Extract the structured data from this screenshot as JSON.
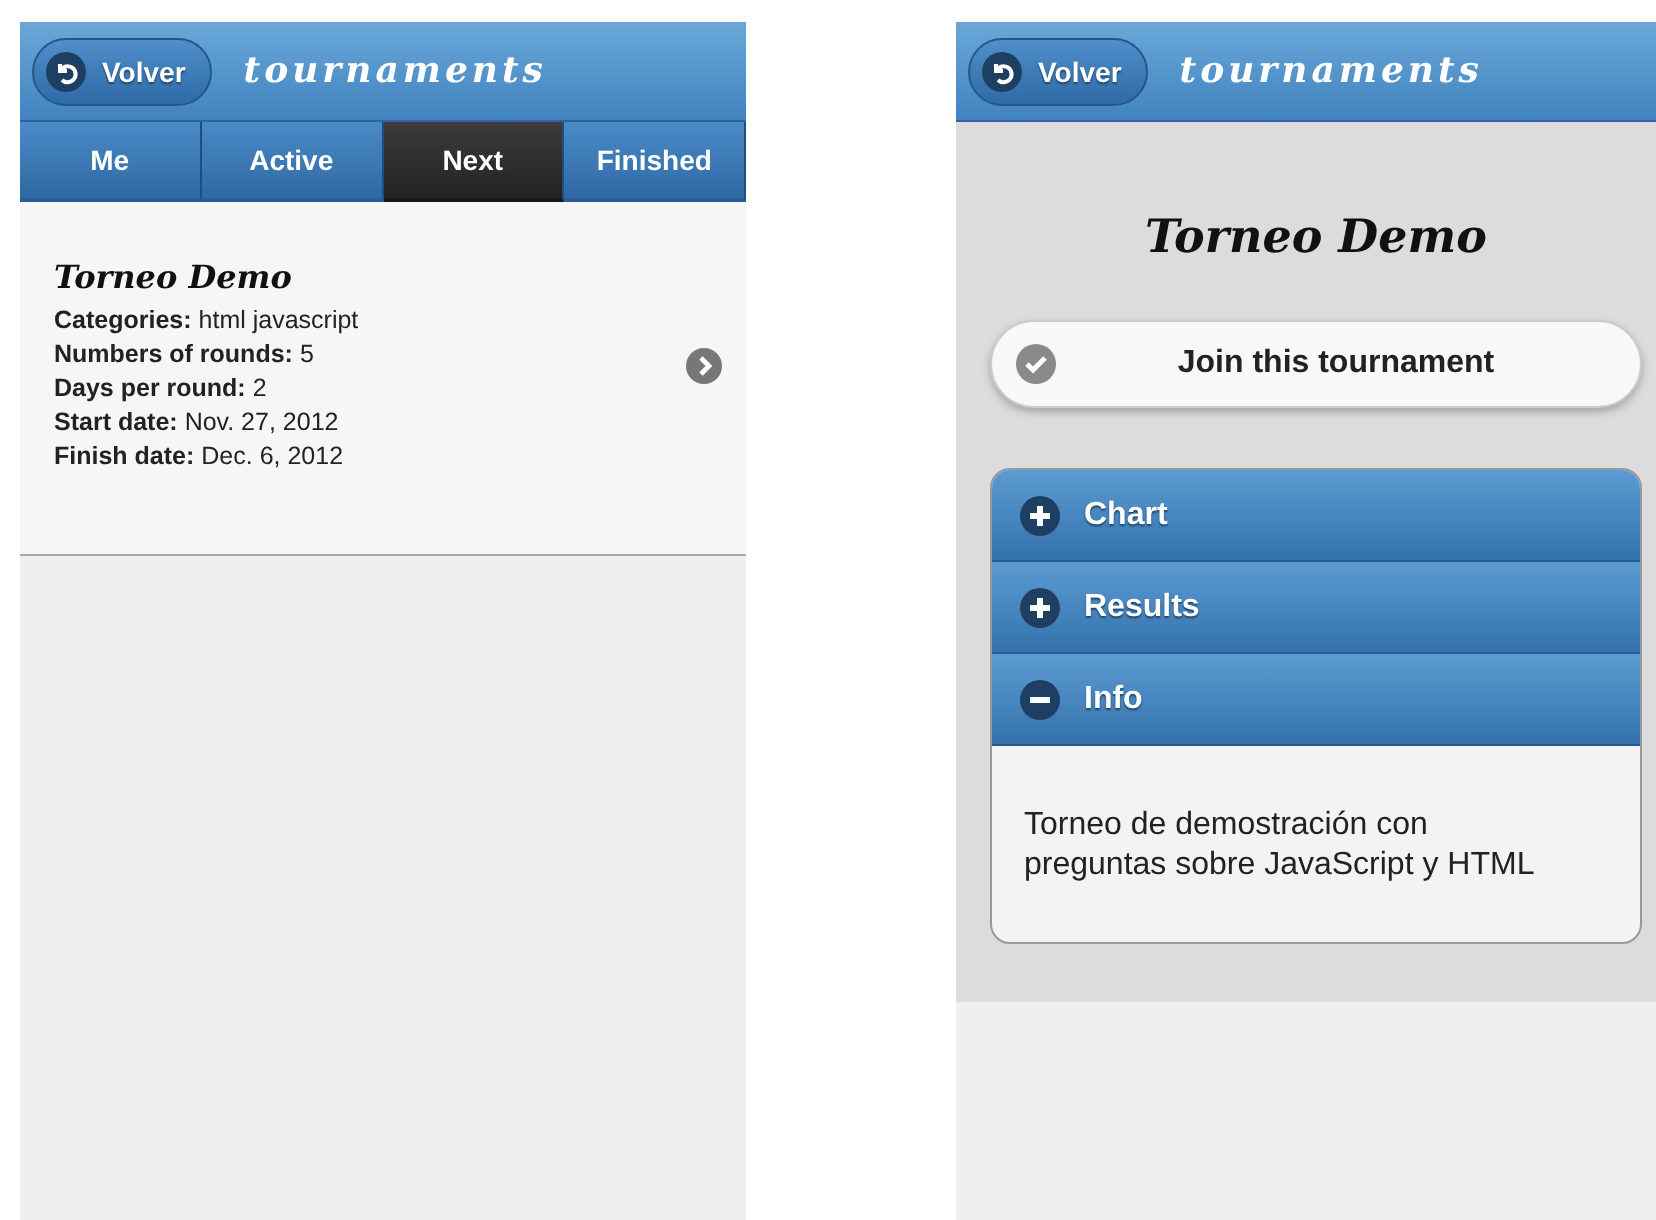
{
  "list_screen": {
    "header": {
      "back_button": "Volver",
      "title": "tournaments"
    },
    "tabs": [
      {
        "label": "Me",
        "selected": false
      },
      {
        "label": "Active",
        "selected": false
      },
      {
        "label": "Next",
        "selected": true
      },
      {
        "label": "Finished",
        "selected": false
      }
    ],
    "items": [
      {
        "title": "Torneo Demo",
        "fields": [
          {
            "label": "Categories:",
            "value": "html javascript"
          },
          {
            "label": "Numbers of rounds:",
            "value": "5"
          },
          {
            "label": "Days per round:",
            "value": "2"
          },
          {
            "label": "Start date:",
            "value": "Nov. 27, 2012"
          },
          {
            "label": "Finish date:",
            "value": "Dec. 6, 2012"
          }
        ]
      }
    ]
  },
  "detail_screen": {
    "header": {
      "back_button": "Volver",
      "title": "tournaments"
    },
    "title": "Torneo Demo",
    "join_button": "Join this tournament",
    "sections": [
      {
        "label": "Chart",
        "expanded": false
      },
      {
        "label": "Results",
        "expanded": false
      },
      {
        "label": "Info",
        "expanded": true,
        "content": "Torneo de demostración con preguntas sobre JavaScript y HTML"
      }
    ]
  }
}
